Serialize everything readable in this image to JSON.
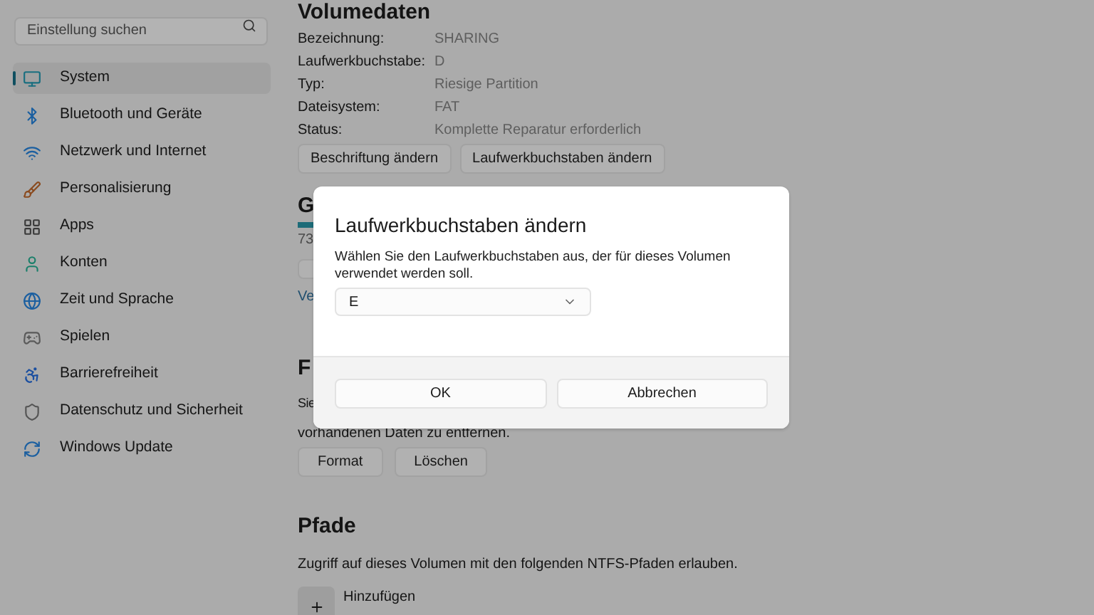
{
  "sidebar": {
    "search": {
      "placeholder": "Einstellung suchen"
    },
    "items": [
      {
        "label": "System",
        "selected": true
      },
      {
        "label": "Bluetooth und Geräte",
        "selected": false
      },
      {
        "label": "Netzwerk und Internet",
        "selected": false
      },
      {
        "label": "Personalisierung",
        "selected": false
      },
      {
        "label": "Apps",
        "selected": false
      },
      {
        "label": "Konten",
        "selected": false
      },
      {
        "label": "Zeit und Sprache",
        "selected": false
      },
      {
        "label": "Spielen",
        "selected": false
      },
      {
        "label": "Barrierefreiheit",
        "selected": false
      },
      {
        "label": "Datenschutz und Sicherheit",
        "selected": false
      },
      {
        "label": "Windows Update",
        "selected": false
      }
    ]
  },
  "volume": {
    "title": "Volumedaten",
    "fields": [
      {
        "label": "Bezeichnung:",
        "value": "SHARING"
      },
      {
        "label": "Laufwerkbuchstabe:",
        "value": "D"
      },
      {
        "label": "Typ:",
        "value": "Riesige Partition"
      },
      {
        "label": "Dateisystem:",
        "value": "FAT"
      },
      {
        "label": "Status:",
        "value": "Komplette Reparatur erforderlich"
      }
    ],
    "buttons": [
      "Beschriftung ändern",
      "Laufwerkbuchstaben ändern"
    ]
  },
  "size": {
    "title": "G",
    "reading": "73",
    "link": "Ve"
  },
  "format": {
    "title": "F",
    "description_line_1": "Sie",
    "description_line_2": "vorhandenen Daten zu entfernen.",
    "buttons": [
      "Format",
      "Löschen"
    ]
  },
  "paths": {
    "title": "Pfade",
    "description": "Zugriff auf dieses Volumen mit den folgenden NTFS-Pfaden erlauben.",
    "add": "Hinzufügen"
  },
  "dialog": {
    "title": "Laufwerkbuchstaben ändern",
    "description": "Wählen Sie den Laufwerkbuchstaben aus, der für dieses Volumen verwendet werden soll.",
    "select_value": "E",
    "buttons": [
      "OK",
      "Abbrechen"
    ]
  }
}
